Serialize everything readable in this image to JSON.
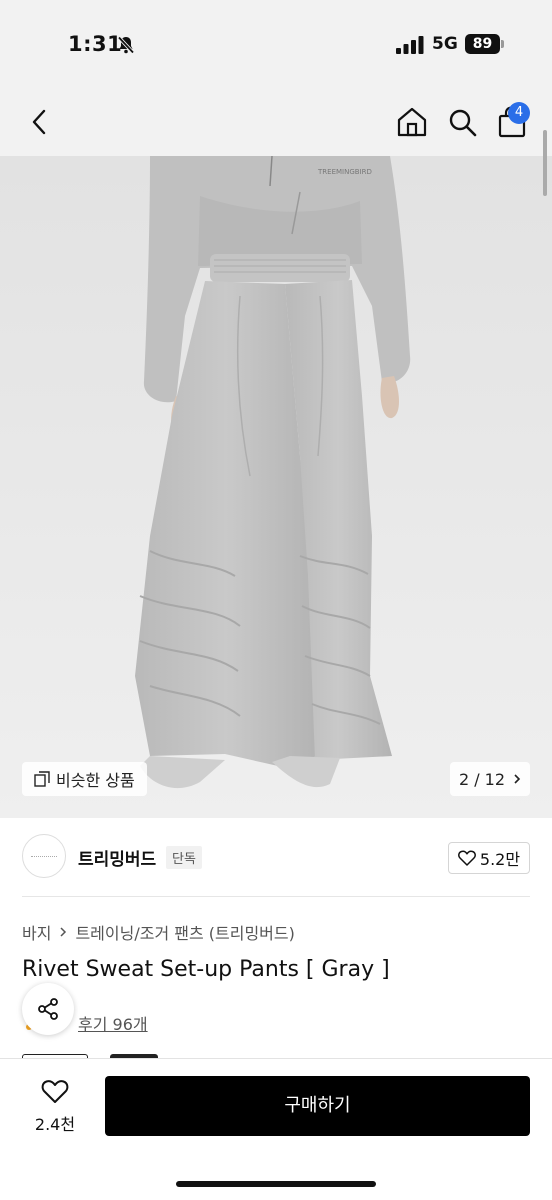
{
  "status_bar": {
    "time": "1:31",
    "network": "5G",
    "battery": "89"
  },
  "nav": {
    "cart_count": "4"
  },
  "gallery": {
    "similar_label": "비슷한 상품",
    "counter": "2 / 12"
  },
  "brand": {
    "name": "트리밍버드",
    "tag": "단독",
    "likes": "5.2만"
  },
  "breadcrumb": {
    "root": "바지",
    "category": "트레이닝/조거 팬츠 (트리밍버드)"
  },
  "product": {
    "title": "Rivet Sweat Set-up Pants [ Gray ]",
    "reviews": "후기 96개"
  },
  "bottom": {
    "wish_count": "2.4천",
    "buy_label": "구매하기"
  },
  "colors": {
    "accent": "#2a6ee8",
    "primary_button": "#000000",
    "review_star": "#f5a623"
  },
  "icons": [
    "bell-slash-icon",
    "signal-icon",
    "back-icon",
    "home-icon",
    "search-icon",
    "bag-icon",
    "similar-icon",
    "chevron-right-icon",
    "heart-icon",
    "share-icon"
  ]
}
